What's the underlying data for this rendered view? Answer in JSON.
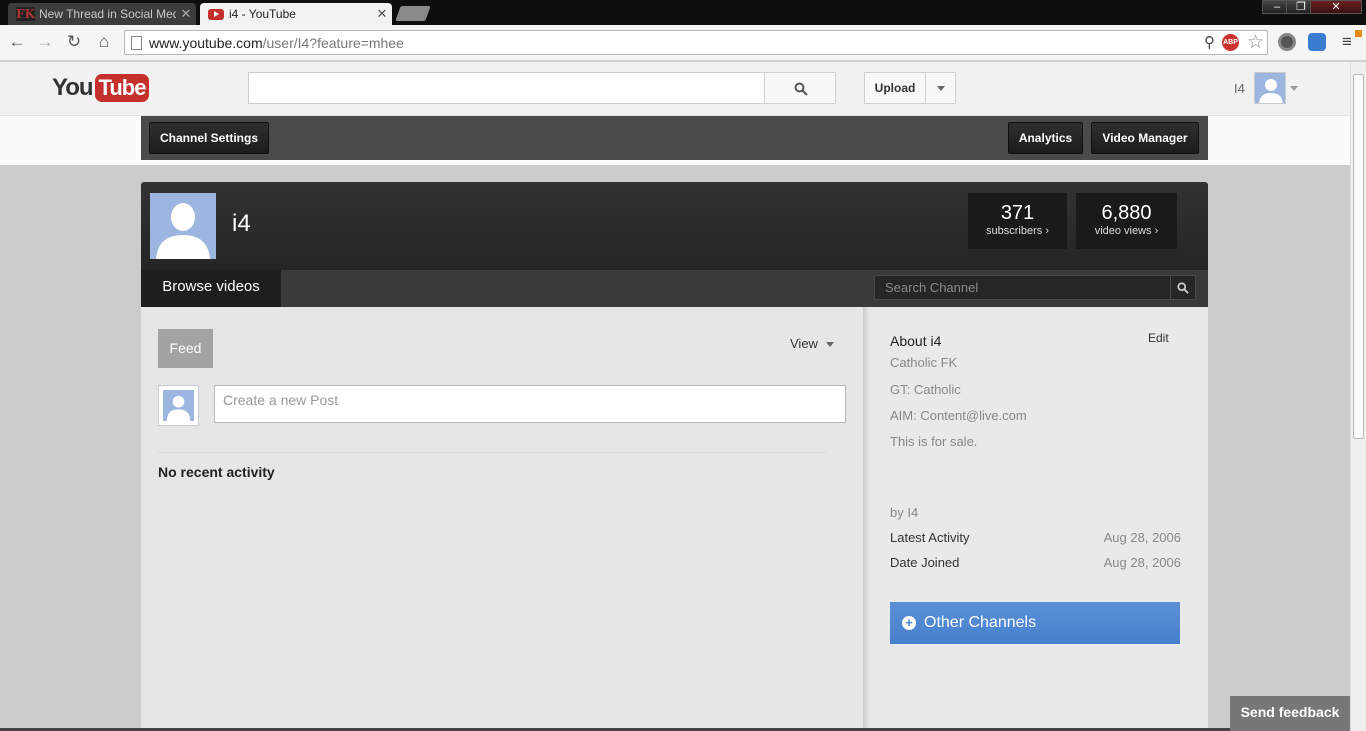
{
  "browser": {
    "tabs": [
      {
        "favicon": "FK",
        "title": "New Thread in Social Medi",
        "active": false
      },
      {
        "favicon": "youtube-icon",
        "title": "i4 - YouTube",
        "active": true
      }
    ],
    "address": {
      "host": "www.youtube.com",
      "path": "/user/I4?feature=mhee"
    }
  },
  "masthead": {
    "logo_you": "You",
    "logo_tube": "Tube",
    "search_placeholder": "",
    "upload_label": "Upload",
    "user_name": "I4"
  },
  "owner_bar": {
    "channel_settings": "Channel Settings",
    "analytics": "Analytics",
    "video_manager": "Video Manager"
  },
  "channel": {
    "name": "i4",
    "stats": [
      {
        "value": "371",
        "label": "subscribers ›"
      },
      {
        "value": "6,880",
        "label": "video views ›"
      }
    ],
    "browse_tab": "Browse videos",
    "search_placeholder": "Search Channel"
  },
  "feed": {
    "tab": "Feed",
    "view_label": "View",
    "post_placeholder": "Create a new Post",
    "empty_message": "No recent activity"
  },
  "about": {
    "title": "About i4",
    "edit": "Edit",
    "lines": [
      "Catholic FK",
      "GT: Catholic",
      "AIM: Content@live.com",
      "This is for sale."
    ],
    "by": "by I4",
    "latest_activity_label": "Latest Activity",
    "latest_activity_value": "Aug 28, 2006",
    "date_joined_label": "Date Joined",
    "date_joined_value": "Aug 28, 2006",
    "other_channels": "Other Channels"
  },
  "send_feedback": "Send feedback",
  "colors": {
    "youtube_red": "#c4302b",
    "other_channels_blue": "#4a84cf"
  }
}
